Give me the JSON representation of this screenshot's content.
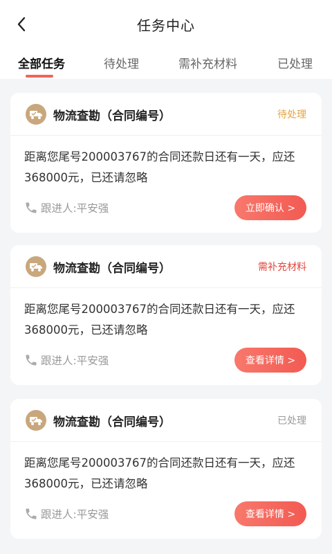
{
  "header": {
    "title": "任务中心"
  },
  "tabs": [
    {
      "label": "全部任务",
      "active": true
    },
    {
      "label": "待处理",
      "active": false
    },
    {
      "label": "需补充材料",
      "active": false
    },
    {
      "label": "已处理",
      "active": false
    }
  ],
  "colors": {
    "accent": "#f0655a",
    "status_pending": "#e9a23b",
    "status_need_material": "#e2463c",
    "status_done": "#999999",
    "icon_bg": "#c9a77d"
  },
  "cards": [
    {
      "icon": "truck-check-icon",
      "title": "物流查勘（合同编号）",
      "status": "待处理",
      "description": "距离您尾号200003767的合同还款日还有一天，应还368000元，已还请忽略",
      "contact": "跟进人:平安强",
      "button": "立即确认 >"
    },
    {
      "icon": "truck-check-icon",
      "title": "物流查勘（合同编号）",
      "status": "需补充材料",
      "description": "距离您尾号200003767的合同还款日还有一天，应还368000元，已还请忽略",
      "contact": "跟进人:平安强",
      "button": "查看详情 >"
    },
    {
      "icon": "truck-check-icon",
      "title": "物流查勘（合同编号）",
      "status": "已处理",
      "description": "距离您尾号200003767的合同还款日还有一天，应还368000元，已还请忽略",
      "contact": "跟进人:平安强",
      "button": "查看详情 >"
    }
  ]
}
